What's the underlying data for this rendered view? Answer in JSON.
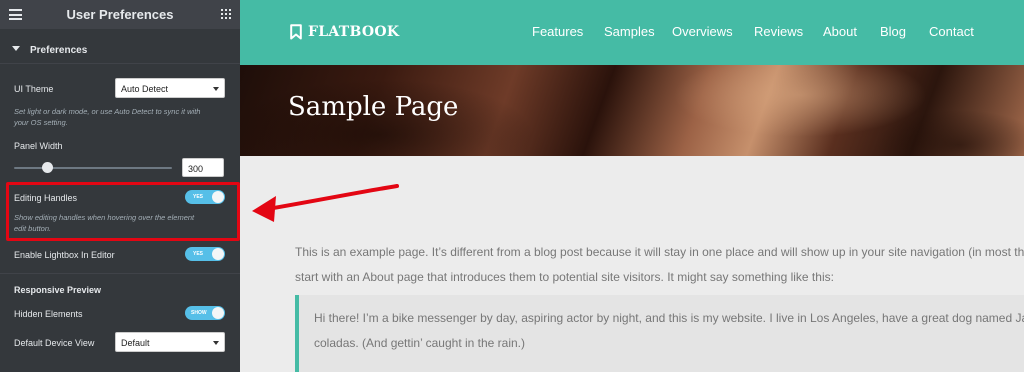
{
  "panel": {
    "title": "User Preferences",
    "section_title": "Preferences",
    "ui_theme": {
      "label": "UI Theme",
      "value": "Auto Detect",
      "help": [
        "Set light or dark mode, or use Auto Detect to sync it with",
        "your OS setting."
      ]
    },
    "panel_width": {
      "label": "Panel Width",
      "value": "300",
      "slider_fraction": 0.21
    },
    "editing_handles": {
      "label": "Editing Handles",
      "toggle": "YES",
      "help": [
        "Show editing handles when hovering over the element",
        "edit button."
      ]
    },
    "lightbox": {
      "label": "Enable Lightbox In Editor",
      "toggle": "YES"
    },
    "responsive_preview": {
      "heading": "Responsive Preview",
      "hidden_elements_label": "Hidden Elements",
      "hidden_elements_toggle": "SHOW",
      "device_view_label": "Default Device View",
      "device_view_value": "Default"
    }
  },
  "site": {
    "logo": "FLATBOOK",
    "nav": [
      "Features",
      "Samples",
      "Overviews",
      "Reviews",
      "About",
      "Blog",
      "Contact"
    ],
    "page_title": "Sample Page",
    "paragraph": [
      "This is an example page. It’s different from a blog post because it will stay in one place and will show up in your site navigation (in most them",
      "start with an About page that introduces them to potential site visitors. It might say something like this:"
    ],
    "quote": [
      "Hi there! I’m a bike messenger by day, aspiring actor by night, and this is my website. I live in Los Angeles, have a great dog named Jack, a",
      "coladas. (And gettin’ caught in the rain.)"
    ]
  },
  "colors": {
    "panel_bg": "#34383c",
    "panel_header": "#404349",
    "toggle_on": "#56bfe8",
    "site_accent": "#45bba5",
    "highlight": "#e30613"
  },
  "icons": [
    "hamburger-menu-icon",
    "grid-apps-icon",
    "caret-down-icon",
    "bookmark-logo-icon",
    "collapse-arrow-icon",
    "annotation-arrow"
  ]
}
